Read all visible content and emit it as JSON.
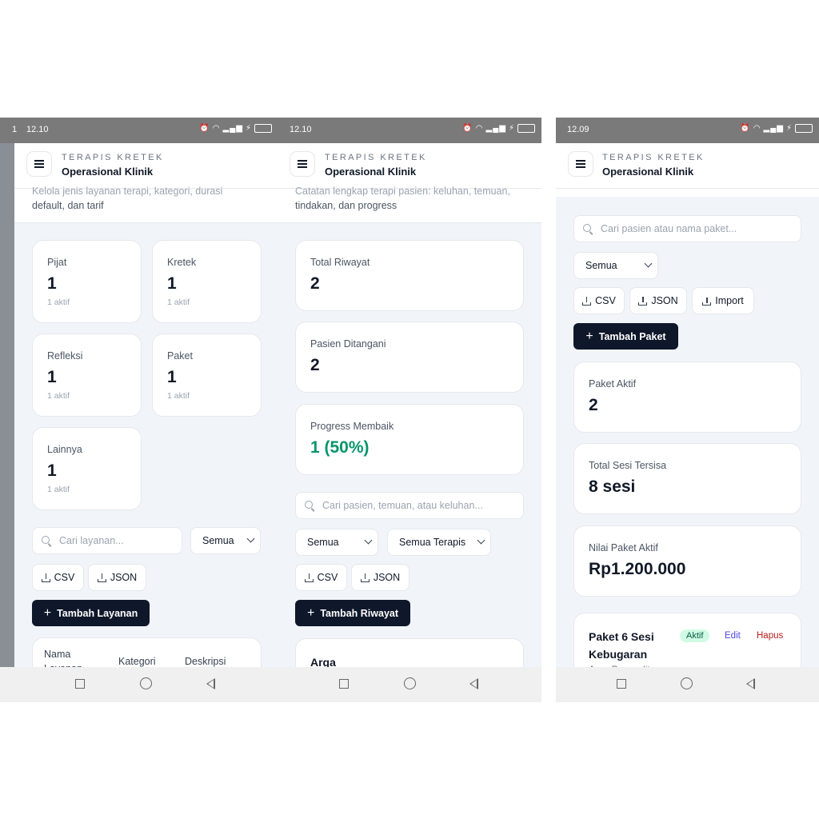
{
  "app": {
    "brand": "TERAPIS KRETEK",
    "title": "Operasional Klinik"
  },
  "screen1": {
    "status_left": "1",
    "time": "12.10",
    "subtitle_partial": "Kelola jenis layanan terapi, kategori, durasi",
    "subtitle_line2": "default, dan tarif",
    "stats": [
      {
        "label": "Pijat",
        "value": "1",
        "note": "1 aktif"
      },
      {
        "label": "Kretek",
        "value": "1",
        "note": "1 aktif"
      },
      {
        "label": "Refleksi",
        "value": "1",
        "note": "1 aktif"
      },
      {
        "label": "Paket",
        "value": "1",
        "note": "1 aktif"
      },
      {
        "label": "Lainnya",
        "value": "1",
        "note": "1 aktif"
      }
    ],
    "search_placeholder": "Cari layanan...",
    "filter": "Semua",
    "csv": "CSV",
    "json": "JSON",
    "add_button": "Tambah Layanan",
    "table_headers": {
      "name_line1": "Nama",
      "name_line2": "Layanan",
      "category": "Kategori",
      "description": "Deskripsi"
    }
  },
  "screen2": {
    "time": "12.10",
    "subtitle_partial": "Catatan lengkap terapi pasien: keluhan, temuan,",
    "subtitle_line2": "tindakan, dan progress",
    "stats": [
      {
        "label": "Total Riwayat",
        "value": "2"
      },
      {
        "label": "Pasien Ditangani",
        "value": "2"
      },
      {
        "label": "Progress Membaik",
        "value": "1 (50%)",
        "color": "#059669"
      }
    ],
    "search_placeholder": "Cari pasien, temuan, atau keluhan...",
    "filter_status": "Semua",
    "filter_therapist": "Semua Terapis",
    "csv": "CSV",
    "json": "JSON",
    "add_button": "Tambah Riwayat",
    "first_record": "Arga"
  },
  "screen3": {
    "time": "12.09",
    "search_placeholder": "Cari pasien atau nama paket...",
    "filter": "Semua",
    "csv": "CSV",
    "json": "JSON",
    "import": "Import",
    "add_button": "Tambah Paket",
    "stats": [
      {
        "label": "Paket Aktif",
        "value": "2"
      },
      {
        "label": "Total Sesi Tersisa",
        "value": "8 sesi"
      },
      {
        "label": "Nilai Paket Aktif",
        "value": "Rp1.200.000"
      }
    ],
    "package": {
      "name_line1": "Paket 6 Sesi",
      "name_line2": "Kebugaran",
      "owner_partial": "Arga Pramudita",
      "status": "Aktif",
      "edit": "Edit",
      "delete": "Hapus"
    }
  },
  "colors": {
    "primary_dark": "#0f172a",
    "success": "#059669",
    "danger": "#b91c1c",
    "link": "#4f46e5"
  }
}
